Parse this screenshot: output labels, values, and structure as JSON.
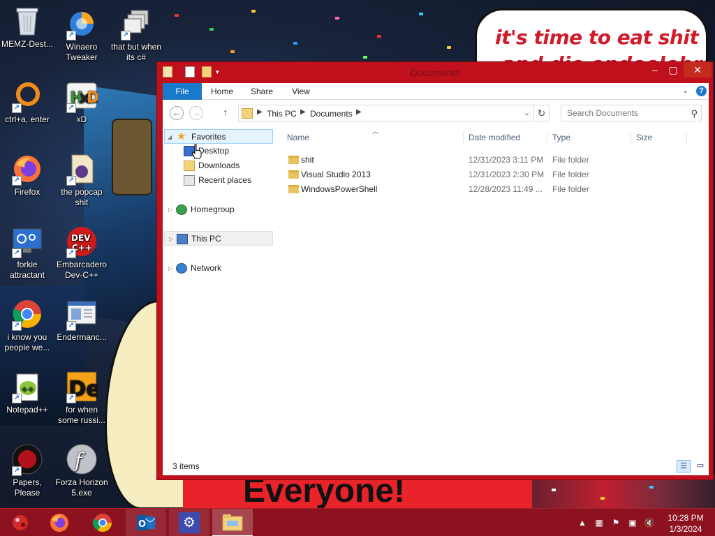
{
  "wallpaper": {
    "bubble_line1": "it's time to eat shit",
    "bubble_line2": "and die ondeelebrate",
    "banner_text": "Everyone!"
  },
  "desktop_icons": [
    {
      "name": "recycle-bin-icon",
      "label": "MEMZ-Dest..."
    },
    {
      "name": "winaero-tweaker-icon",
      "label": "Winaero Tweaker"
    },
    {
      "name": "stacked-windows-icon",
      "label": "that but when its c#"
    },
    {
      "name": "orange-ring-icon",
      "label": "ctrl+a, enter"
    },
    {
      "name": "hxd-hex-editor-icon",
      "label": "xD"
    },
    {
      "name": "firefox-icon",
      "label": "Firefox"
    },
    {
      "name": "media-file-icon",
      "label": "the popcap shit"
    },
    {
      "name": "system-monitor-icon",
      "label": "forkie attractant"
    },
    {
      "name": "dev-cpp-icon",
      "label": "Embarcadero Dev-C++"
    },
    {
      "name": "chrome-icon",
      "label": "i know you people we..."
    },
    {
      "name": "window-app-icon",
      "label": "Endermanc..."
    },
    {
      "name": "notepad-plus-plus-icon",
      "label": "Notepad++"
    },
    {
      "name": "de-app-icon",
      "label": "for when some russi..."
    },
    {
      "name": "papers-please-icon",
      "label": "Papers, Please"
    },
    {
      "name": "flash-player-icon",
      "label": "Forza Horizon 5.exe"
    }
  ],
  "window": {
    "title": "Documents",
    "ribbon_tabs": [
      "File",
      "Home",
      "Share",
      "View"
    ],
    "help": "?",
    "address": {
      "crumbs": [
        "This PC",
        "Documents"
      ]
    },
    "search": {
      "placeholder": "Search Documents"
    },
    "nav": {
      "favorites": "Favorites",
      "desktop": "Desktop",
      "downloads": "Downloads",
      "recent": "Recent places",
      "homegroup": "Homegroup",
      "this_pc": "This PC",
      "network": "Network"
    },
    "columns": [
      "Name",
      "Date modified",
      "Type",
      "Size"
    ],
    "files": [
      {
        "name": "shit",
        "date": "12/31/2023 3:11 PM",
        "type": "File folder"
      },
      {
        "name": "Visual Studio 2013",
        "date": "12/31/2023 2:30 PM",
        "type": "File folder"
      },
      {
        "name": "WindowsPowerShell",
        "date": "12/28/2023 11:49 ...",
        "type": "File folder"
      }
    ],
    "status": "3 items"
  },
  "taskbar": {
    "apps": [
      "memz-icon",
      "firefox-icon",
      "chrome-icon",
      "outlook-icon",
      "settings-icon",
      "file-explorer-icon"
    ],
    "clock_time": "10:28 PM",
    "clock_date": "1/3/2024"
  },
  "colors": {
    "window_frame": "#c0101c",
    "taskbar": "#8c1220",
    "ribbon_file_tab": "#1979ca",
    "selection": "#e5f3ff"
  }
}
